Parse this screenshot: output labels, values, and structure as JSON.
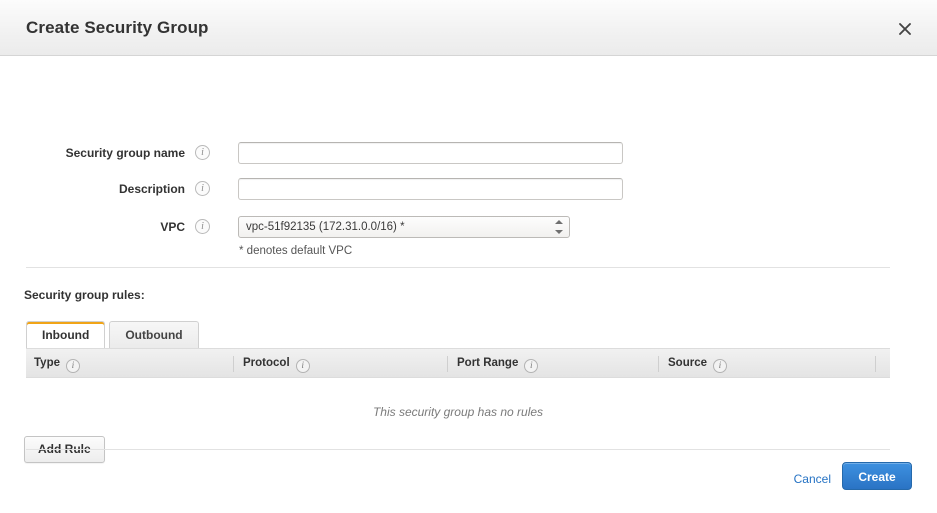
{
  "dialog": {
    "title": "Create Security Group",
    "close_icon": "close-icon"
  },
  "form": {
    "fields": [
      {
        "label": "Security group name",
        "type": "text",
        "value": "",
        "placeholder": "",
        "info_icon": "info-icon"
      },
      {
        "label": "Description",
        "type": "text",
        "value": "",
        "placeholder": "",
        "info_icon": "info-icon"
      },
      {
        "label": "VPC",
        "type": "select",
        "value": "vpc-51f92135 (172.31.0.0/16) *",
        "info_icon": "info-icon"
      }
    ],
    "vpc_note": "* denotes default VPC"
  },
  "rules": {
    "section_label": "Security group rules:",
    "tabs": [
      {
        "label": "Inbound",
        "active": true
      },
      {
        "label": "Outbound",
        "active": false
      }
    ],
    "columns": [
      {
        "label": "Type",
        "info_icon": "info-icon"
      },
      {
        "label": "Protocol",
        "info_icon": "info-icon"
      },
      {
        "label": "Port Range",
        "info_icon": "info-icon"
      },
      {
        "label": "Source",
        "info_icon": "info-icon"
      }
    ],
    "rows": [],
    "empty_message": "This security group has no rules",
    "add_rule_label": "Add Rule"
  },
  "footer": {
    "cancel_label": "Cancel",
    "create_label": "Create"
  },
  "colors": {
    "accent_tab": "#f0a417",
    "primary_button": "#2a73c4",
    "link": "#2673c4"
  }
}
